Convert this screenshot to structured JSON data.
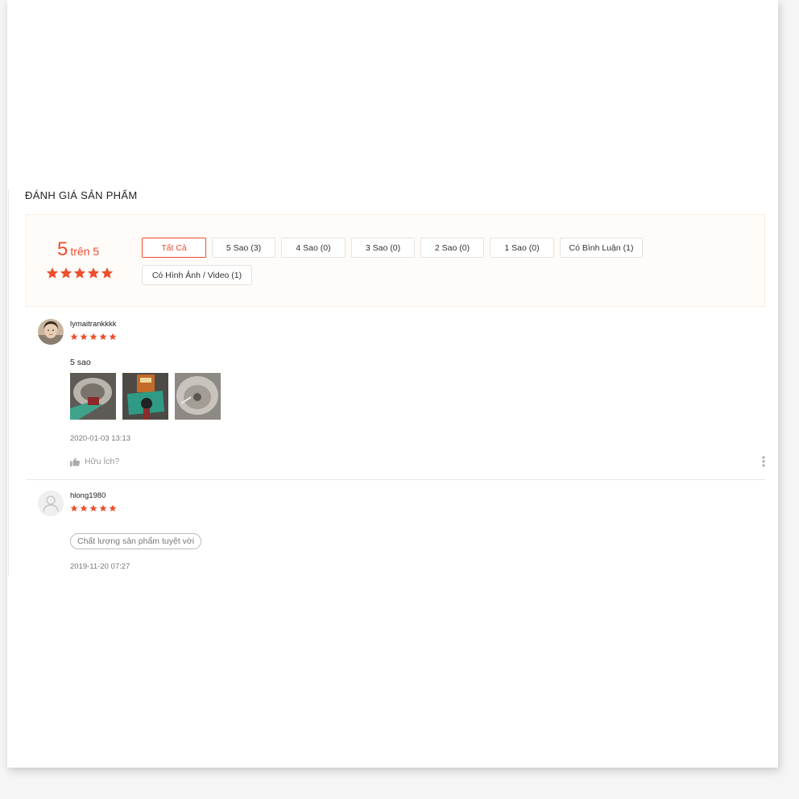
{
  "section": {
    "title": "ĐÁNH GIÁ SẢN PHẨM"
  },
  "summary": {
    "score": "5",
    "out_of": "trên 5",
    "stars": 5
  },
  "filters": [
    {
      "label": "Tất Cả",
      "active": true
    },
    {
      "label": "5 Sao (3)",
      "active": false
    },
    {
      "label": "4 Sao (0)",
      "active": false
    },
    {
      "label": "3 Sao (0)",
      "active": false
    },
    {
      "label": "2 Sao (0)",
      "active": false
    },
    {
      "label": "1 Sao (0)",
      "active": false
    },
    {
      "label": "Có Bình Luận (1)",
      "active": false
    },
    {
      "label": "Có Hình Ảnh / Video (1)",
      "active": false
    }
  ],
  "reviews": [
    {
      "username": "lymaitrankkkk",
      "rating": 5,
      "text": "5 sao",
      "images": [
        "product-photo-1",
        "product-photo-2",
        "product-photo-3"
      ],
      "timestamp": "2020-01-03 13:13",
      "helpful_label": "Hữu Ích?"
    },
    {
      "username": "hlong1980",
      "rating": 5,
      "tag": "Chất lượng sản phẩm tuyệt vời",
      "timestamp": "2019-11-20 07:27"
    }
  ],
  "colors": {
    "accent": "#ee4d2d",
    "panel_bg": "#fffbf8"
  },
  "icons": {
    "star": "star-icon",
    "thumb_up": "thumbs-up-icon",
    "more": "more-vertical-icon",
    "default_avatar": "user-icon"
  }
}
